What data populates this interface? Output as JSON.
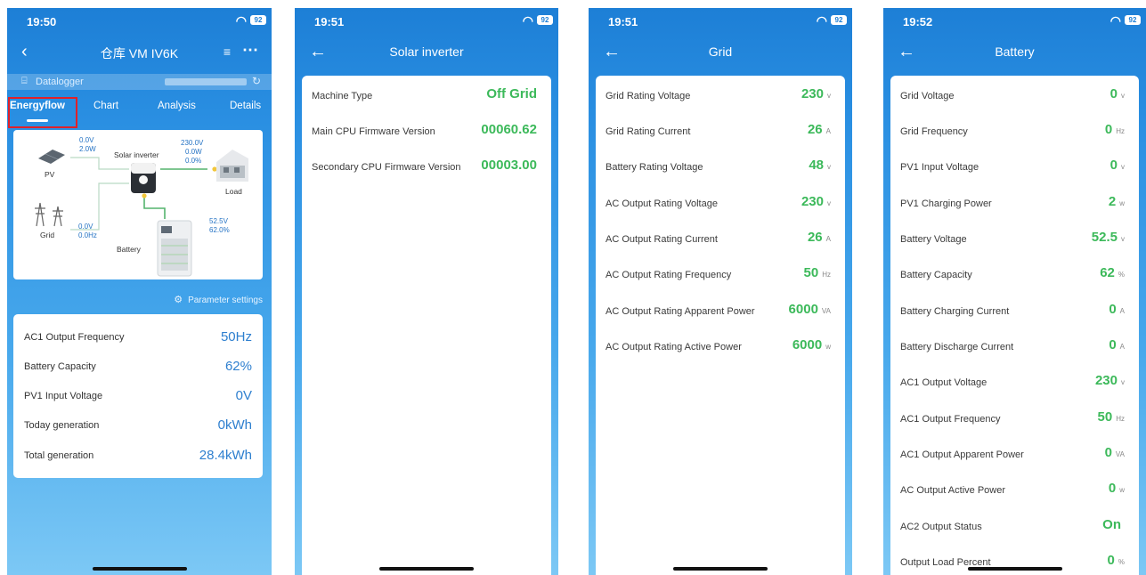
{
  "screen1": {
    "time": "19:50",
    "battery_level": "92",
    "title": "仓库 VM IV6K",
    "datalogger_label": "Datalogger",
    "tabs": [
      "Energyflow",
      "Chart",
      "Analysis",
      "Details"
    ],
    "flow": {
      "pv_label": "PV",
      "pv_voltage": "0.0V",
      "pv_power": "2.0W",
      "inverter_label": "Solar inverter",
      "out_voltage": "230.0V",
      "out_power": "0.0W",
      "out_percent": "0.0%",
      "load_label": "Load",
      "grid_label": "Grid",
      "grid_voltage": "0.0V",
      "grid_freq": "0.0Hz",
      "battery_label": "Battery",
      "battery_voltage": "52.5V",
      "battery_percent": "62.0%"
    },
    "parameter_settings": "Parameter settings",
    "rows": [
      {
        "label": "AC1 Output Frequency",
        "value": "50Hz"
      },
      {
        "label": "Battery Capacity",
        "value": "62%"
      },
      {
        "label": "PV1 Input Voltage",
        "value": "0V"
      },
      {
        "label": "Today generation",
        "value": "0kWh"
      },
      {
        "label": "Total generation",
        "value": "28.4kWh"
      }
    ]
  },
  "screen2": {
    "time": "19:51",
    "battery_level": "92",
    "title": "Solar inverter",
    "rows": [
      {
        "label": "Machine Type",
        "value": "Off Grid"
      },
      {
        "label": "Main CPU Firmware Version",
        "value": "00060.62"
      },
      {
        "label": "Secondary CPU Firmware Version",
        "value": "00003.00"
      }
    ]
  },
  "screen3": {
    "time": "19:51",
    "battery_level": "92",
    "title": "Grid",
    "rows": [
      {
        "label": "Grid Rating Voltage",
        "value": "230",
        "unit": "v"
      },
      {
        "label": "Grid Rating Current",
        "value": "26",
        "unit": "A"
      },
      {
        "label": "Battery Rating Voltage",
        "value": "48",
        "unit": "v"
      },
      {
        "label": "AC Output Rating Voltage",
        "value": "230",
        "unit": "v"
      },
      {
        "label": "AC Output Rating Current",
        "value": "26",
        "unit": "A"
      },
      {
        "label": "AC Output Rating Frequency",
        "value": "50",
        "unit": "Hz"
      },
      {
        "label": "AC Output Rating Apparent Power",
        "value": "6000",
        "unit": "VA"
      },
      {
        "label": "AC Output Rating Active Power",
        "value": "6000",
        "unit": "w"
      }
    ]
  },
  "screen4": {
    "time": "19:52",
    "battery_level": "92",
    "title": "Battery",
    "rows": [
      {
        "label": "Grid Voltage",
        "value": "0",
        "unit": "v"
      },
      {
        "label": "Grid Frequency",
        "value": "0",
        "unit": "Hz"
      },
      {
        "label": "PV1 Input Voltage",
        "value": "0",
        "unit": "v"
      },
      {
        "label": "PV1 Charging Power",
        "value": "2",
        "unit": "w"
      },
      {
        "label": "Battery Voltage",
        "value": "52.5",
        "unit": "v"
      },
      {
        "label": "Battery Capacity",
        "value": "62",
        "unit": "%"
      },
      {
        "label": "Battery Charging Current",
        "value": "0",
        "unit": "A"
      },
      {
        "label": "Battery Discharge Current",
        "value": "0",
        "unit": "A"
      },
      {
        "label": "AC1 Output Voltage",
        "value": "230",
        "unit": "v"
      },
      {
        "label": "AC1 Output Frequency",
        "value": "50",
        "unit": "Hz"
      },
      {
        "label": "AC1 Output Apparent Power",
        "value": "0",
        "unit": "VA"
      },
      {
        "label": "AC Output Active Power",
        "value": "0",
        "unit": "w"
      },
      {
        "label": "AC2 Output Status",
        "value": "On",
        "unit": ""
      },
      {
        "label": "Output Load Percent",
        "value": "0",
        "unit": "%"
      }
    ]
  },
  "icons": {
    "back": "arrow-left-icon",
    "wifi": "wifi-icon",
    "more": "more-icon",
    "settings": "gear-icon"
  },
  "colors": {
    "accent_blue": "#2e7fcf",
    "value_green": "#3cb95a",
    "highlight_red": "#e0212a"
  }
}
